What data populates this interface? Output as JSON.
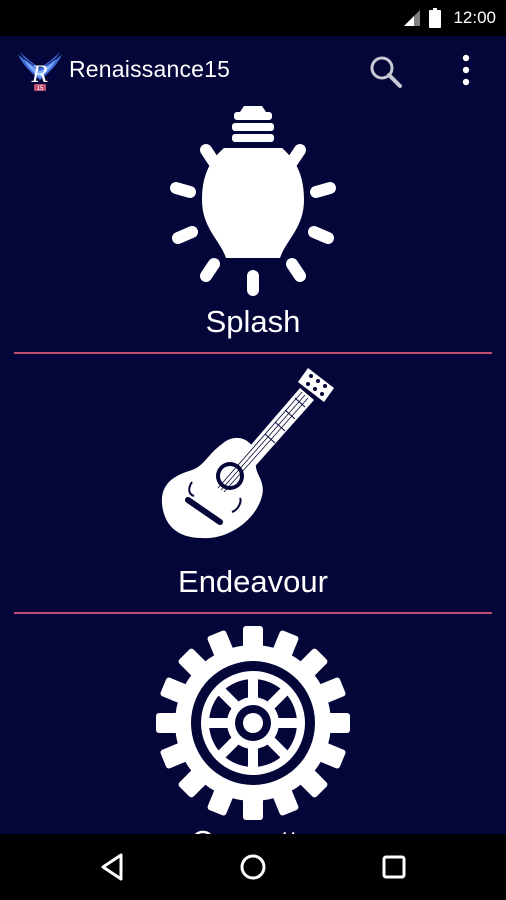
{
  "status_bar": {
    "time": "12:00"
  },
  "app_bar": {
    "title": "Renaissance15",
    "logo_letter": "R",
    "logo_number": "15"
  },
  "menu": {
    "items": [
      {
        "label": "Splash",
        "icon": "light-bulb-icon"
      },
      {
        "label": "Endeavour",
        "icon": "guitar-icon"
      },
      {
        "label": "Concetto",
        "icon": "gear-icon"
      }
    ]
  },
  "colors": {
    "background": "#040538",
    "divider": "#c0506f",
    "system_bars": "#000000"
  }
}
